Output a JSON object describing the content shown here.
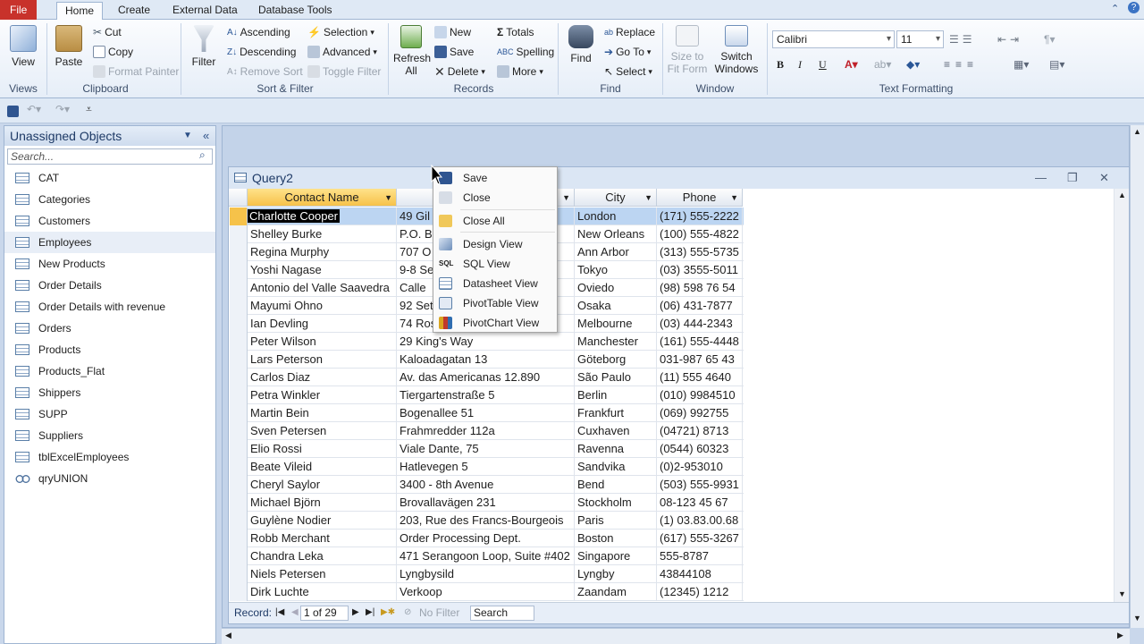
{
  "ribbon": {
    "tabs": [
      "File",
      "Home",
      "Create",
      "External Data",
      "Database Tools"
    ],
    "active_tab": "Home",
    "views": {
      "view_label": "View",
      "group": "Views"
    },
    "clipboard": {
      "paste": "Paste",
      "cut": "Cut",
      "copy": "Copy",
      "format_painter": "Format Painter",
      "group": "Clipboard"
    },
    "sort_filter": {
      "filter": "Filter",
      "ascending": "Ascending",
      "descending": "Descending",
      "remove_sort": "Remove Sort",
      "selection": "Selection",
      "advanced": "Advanced",
      "toggle_filter": "Toggle Filter",
      "group": "Sort & Filter"
    },
    "records": {
      "refresh": "Refresh",
      "refresh2": "All",
      "new": "New",
      "save": "Save",
      "delete": "Delete",
      "totals": "Totals",
      "spelling": "Spelling",
      "more": "More",
      "group": "Records"
    },
    "find": {
      "find": "Find",
      "replace": "Replace",
      "goto": "Go To",
      "select": "Select",
      "group": "Find"
    },
    "window": {
      "size_to": "Size to",
      "fit_form": "Fit Form",
      "switch": "Switch",
      "windows": "Windows",
      "group": "Window"
    },
    "text_formatting": {
      "font": "Calibri",
      "size": "11",
      "bold": "B",
      "italic": "I",
      "underline": "U",
      "group": "Text Formatting"
    }
  },
  "nav": {
    "title": "Unassigned Objects",
    "search_placeholder": "Search...",
    "items": [
      {
        "label": "CAT",
        "type": "table"
      },
      {
        "label": "Categories",
        "type": "table"
      },
      {
        "label": "Customers",
        "type": "table"
      },
      {
        "label": "Employees",
        "type": "table"
      },
      {
        "label": "New Products",
        "type": "table"
      },
      {
        "label": "Order Details",
        "type": "table"
      },
      {
        "label": "Order Details with revenue",
        "type": "table"
      },
      {
        "label": "Orders",
        "type": "table"
      },
      {
        "label": "Products",
        "type": "table"
      },
      {
        "label": "Products_Flat",
        "type": "table"
      },
      {
        "label": "Shippers",
        "type": "table"
      },
      {
        "label": "SUPP",
        "type": "table"
      },
      {
        "label": "Suppliers",
        "type": "table"
      },
      {
        "label": "tblExcelEmployees",
        "type": "table"
      },
      {
        "label": "qryUNION",
        "type": "query"
      }
    ]
  },
  "query": {
    "title": "Query2",
    "columns": [
      "Contact Name",
      "",
      "City",
      "Phone"
    ],
    "rows": [
      [
        "Charlotte Cooper",
        "49 Gil",
        "London",
        "(171) 555-2222"
      ],
      [
        "Shelley Burke",
        "P.O. B",
        "New Orleans",
        "(100) 555-4822"
      ],
      [
        "Regina Murphy",
        "707 O",
        "Ann Arbor",
        "(313) 555-5735"
      ],
      [
        "Yoshi Nagase",
        "9-8 Se",
        "Tokyo",
        "(03) 3555-5011"
      ],
      [
        "Antonio del Valle Saavedra",
        "Calle",
        "Oviedo",
        "(98) 598 76 54"
      ],
      [
        "Mayumi Ohno",
        "92 Set",
        "Osaka",
        "(06) 431-7877"
      ],
      [
        "Ian Devling",
        "74 Ros",
        "Melbourne",
        "(03) 444-2343"
      ],
      [
        "Peter Wilson",
        "29 King's Way",
        "Manchester",
        "(161) 555-4448"
      ],
      [
        "Lars Peterson",
        "Kaloadagatan 13",
        "Göteborg",
        "031-987 65 43"
      ],
      [
        "Carlos Diaz",
        "Av. das Americanas 12.890",
        "São Paulo",
        "(11) 555 4640"
      ],
      [
        "Petra Winkler",
        "Tiergartenstraße 5",
        "Berlin",
        "(010) 9984510"
      ],
      [
        "Martin Bein",
        "Bogenallee 51",
        "Frankfurt",
        "(069) 992755"
      ],
      [
        "Sven Petersen",
        "Frahmredder 112a",
        "Cuxhaven",
        "(04721) 8713"
      ],
      [
        "Elio Rossi",
        "Viale Dante, 75",
        "Ravenna",
        "(0544) 60323"
      ],
      [
        "Beate Vileid",
        "Hatlevegen 5",
        "Sandvika",
        "(0)2-953010"
      ],
      [
        "Cheryl Saylor",
        "3400 - 8th Avenue",
        "Bend",
        "(503) 555-9931"
      ],
      [
        "Michael Björn",
        "Brovallavägen 231",
        "Stockholm",
        "08-123 45 67"
      ],
      [
        "Guylène Nodier",
        "203, Rue des Francs-Bourgeois",
        "Paris",
        "(1) 03.83.00.68"
      ],
      [
        "Robb Merchant",
        "Order Processing Dept.",
        "Boston",
        "(617) 555-3267"
      ],
      [
        "Chandra Leka",
        "471 Serangoon Loop, Suite #402",
        "Singapore",
        "555-8787"
      ],
      [
        "Niels Petersen",
        "Lyngbysild",
        "Lyngby",
        "43844108"
      ],
      [
        "Dirk Luchte",
        "Verkoop",
        "Zaandam",
        "(12345) 1212"
      ]
    ],
    "record_label": "Record:",
    "record_pos": "1 of 29",
    "no_filter": "No Filter",
    "search": "Search"
  },
  "context_menu": {
    "items": [
      "Save",
      "Close",
      "Close All",
      "Design View",
      "SQL View",
      "Datasheet View",
      "PivotTable View",
      "PivotChart View"
    ],
    "sql_icon": "SQL"
  },
  "colors": {
    "accent": "#f6c24a",
    "file_tab": "#c8322b",
    "selection": "#bcd5f2"
  }
}
